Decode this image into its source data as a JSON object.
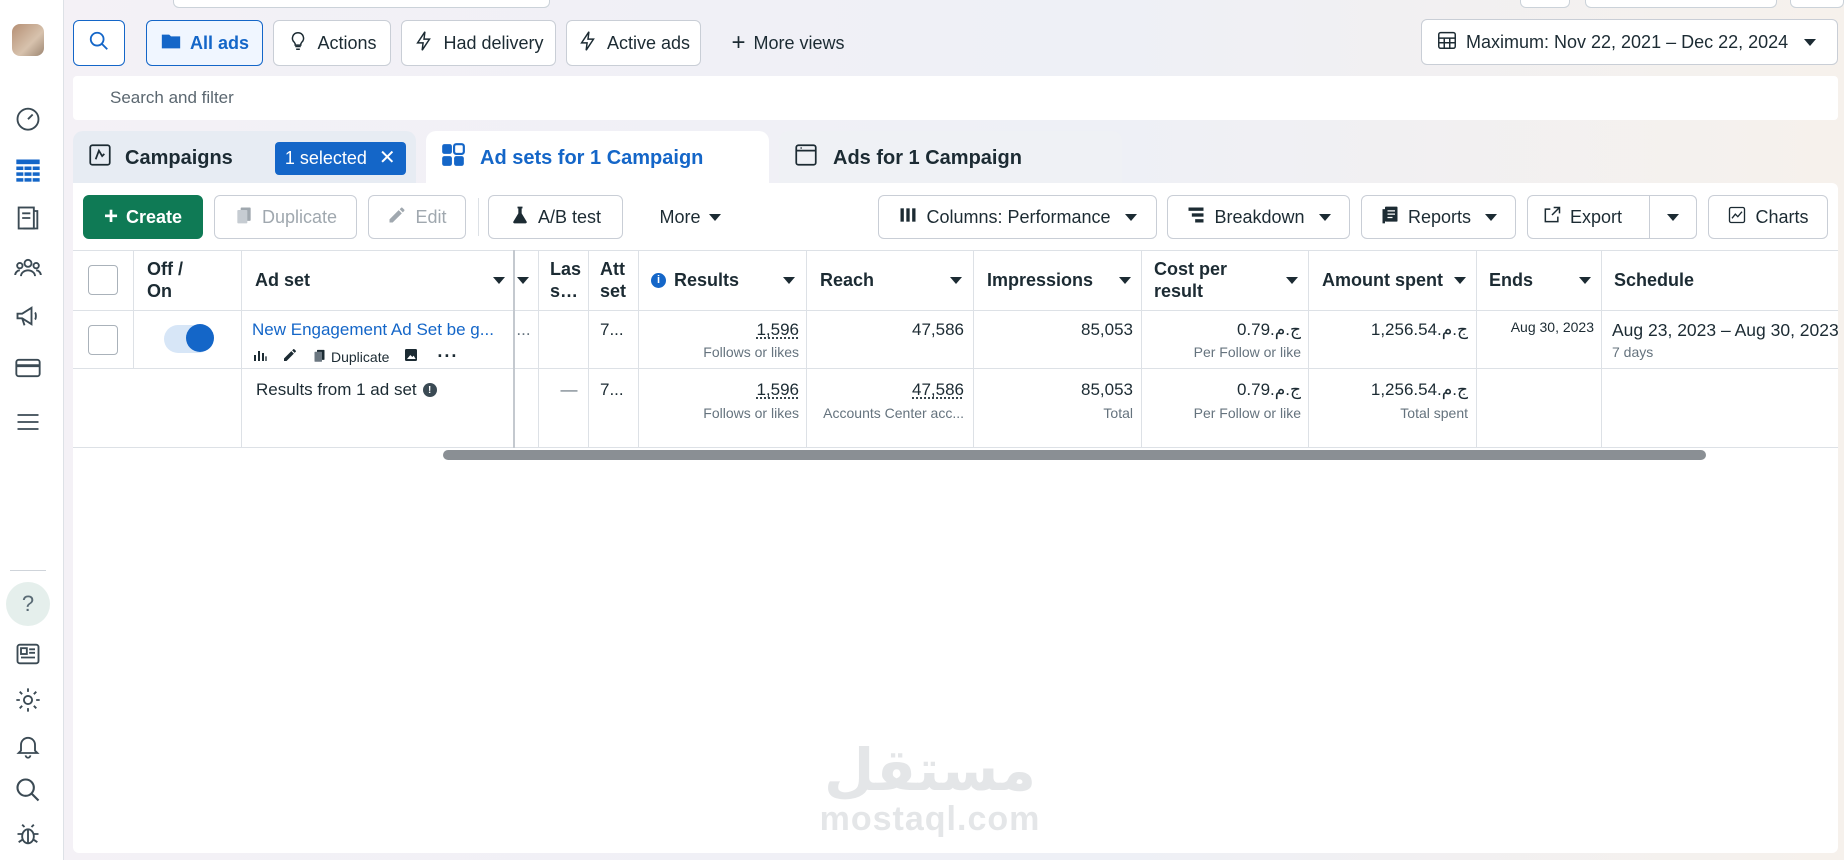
{
  "top_filters": {
    "search_label": "Search",
    "all_ads": "All ads",
    "actions": "Actions",
    "had_delivery": "Had delivery",
    "active_ads": "Active ads",
    "more_views": "More views",
    "date_range": "Maximum: Nov 22, 2021 – Dec 22, 2024"
  },
  "search": {
    "placeholder": "Search and filter"
  },
  "tabs": {
    "campaigns": "Campaigns",
    "selected_badge": "1 selected",
    "adsets": "Ad sets for 1 Campaign",
    "ads": "Ads for 1 Campaign"
  },
  "toolbar": {
    "create": "Create",
    "duplicate": "Duplicate",
    "edit": "Edit",
    "ab_test": "A/B test",
    "more": "More",
    "columns": "Columns: Performance",
    "breakdown": "Breakdown",
    "reports": "Reports",
    "export": "Export",
    "charts": "Charts"
  },
  "table": {
    "headers": {
      "off_on_1": "Off /",
      "off_on_2": "On",
      "adset": "Ad set",
      "las1": "Las",
      "las2": "s…",
      "att1": "Att",
      "att2": "set",
      "results": "Results",
      "reach": "Reach",
      "impressions": "Impressions",
      "cpr1": "Cost per",
      "cpr2": "result",
      "amount": "Amount spent",
      "ends": "Ends",
      "schedule": "Schedule"
    },
    "row": {
      "name": "New Engagement Ad Set be g...",
      "action_duplicate": "Duplicate",
      "trunc1": "...",
      "att": "7...",
      "results": "1,596",
      "results_sub": "Follows or likes",
      "reach": "47,586",
      "impressions": "85,053",
      "cpr": "ج.م.0.79",
      "cpr_sub": "Per Follow or like",
      "amount": "ج.م.1,256.54",
      "ends": "Aug 30, 2023",
      "schedule": "Aug 23, 2023 – Aug 30, 2023",
      "schedule_sub": "7 days",
      "on": true
    },
    "summary": {
      "label": "Results from 1 ad set",
      "las": "—",
      "att": "7...",
      "results": "1,596",
      "results_sub": "Follows or likes",
      "reach": "47,586",
      "reach_sub": "Accounts Center acc...",
      "impressions": "85,053",
      "impressions_sub": "Total",
      "cpr": "ج.م.0.79",
      "cpr_sub": "Per Follow or like",
      "amount": "ج.م.1,256.54",
      "amount_sub": "Total spent"
    }
  },
  "watermark": {
    "arabic": "مستقل",
    "latin": "mostaql.com"
  },
  "colors": {
    "accent": "#1466c8",
    "create": "#0f7a55"
  }
}
